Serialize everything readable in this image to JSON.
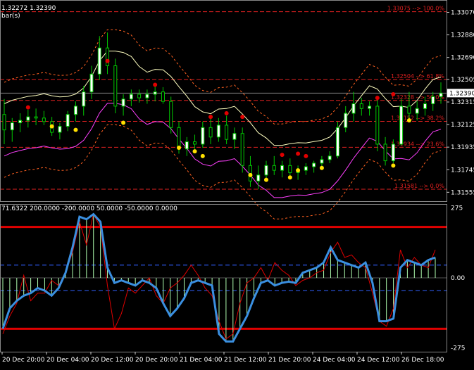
{
  "chart_data": [
    {
      "type": "candlestick",
      "header": {
        "price_text": "1.32272 1.32390",
        "indicator_text": "bar(s)"
      },
      "y_ticks": [
        "1.33070",
        "1.32880",
        "1.32690",
        "1.32505",
        "1.32315",
        "1.32125",
        "1.31935",
        "1.31745",
        "1.31555"
      ],
      "y_range": [
        1.3148,
        1.3315
      ],
      "current_price": "1.32390",
      "fibonacci": [
        {
          "label": "1.33075 --> 100.0%",
          "price": 1.33075
        },
        {
          "label": "1.32504 --> 61.8%",
          "price": 1.32504
        },
        {
          "label": "1.32328 --> 50.0%",
          "price": 1.32328
        },
        {
          "label": "1.32152 --> 38.2%",
          "price": 1.32152
        },
        {
          "label": "1.31934 --> 23.6%",
          "price": 1.31934
        },
        {
          "label": "1.31581 --> 0.0%",
          "price": 1.31581
        }
      ],
      "candles": [
        [
          1.3221,
          1.3234,
          1.3196,
          1.3208
        ],
        [
          1.3208,
          1.3218,
          1.3198,
          1.3214
        ],
        [
          1.3214,
          1.3222,
          1.3206,
          1.3216
        ],
        [
          1.3216,
          1.3225,
          1.321,
          1.3219
        ],
        [
          1.3219,
          1.3226,
          1.3212,
          1.3218
        ],
        [
          1.3218,
          1.3224,
          1.3212,
          1.3215
        ],
        [
          1.3215,
          1.3219,
          1.3203,
          1.3206
        ],
        [
          1.3206,
          1.3214,
          1.32,
          1.3211
        ],
        [
          1.3211,
          1.3224,
          1.3207,
          1.3221
        ],
        [
          1.3221,
          1.3232,
          1.3215,
          1.3228
        ],
        [
          1.3228,
          1.3245,
          1.322,
          1.324
        ],
        [
          1.324,
          1.3262,
          1.3234,
          1.3255
        ],
        [
          1.3255,
          1.3287,
          1.325,
          1.3277
        ],
        [
          1.3277,
          1.329,
          1.3255,
          1.3262
        ],
        [
          1.3262,
          1.3268,
          1.3222,
          1.3228
        ],
        [
          1.3228,
          1.3238,
          1.322,
          1.3234
        ],
        [
          1.3234,
          1.3242,
          1.3228,
          1.3238
        ],
        [
          1.3238,
          1.3242,
          1.3231,
          1.3235
        ],
        [
          1.3235,
          1.3242,
          1.323,
          1.3238
        ],
        [
          1.3238,
          1.3245,
          1.3232,
          1.324
        ],
        [
          1.324,
          1.3244,
          1.323,
          1.3232
        ],
        [
          1.3232,
          1.3236,
          1.3205,
          1.321
        ],
        [
          1.321,
          1.3215,
          1.3188,
          1.3192
        ],
        [
          1.3192,
          1.3202,
          1.3186,
          1.3198
        ],
        [
          1.3198,
          1.3204,
          1.3192,
          1.3196
        ],
        [
          1.3196,
          1.3215,
          1.3193,
          1.321
        ],
        [
          1.321,
          1.322,
          1.3196,
          1.3202
        ],
        [
          1.3202,
          1.3218,
          1.3198,
          1.3212
        ],
        [
          1.3212,
          1.322,
          1.3196,
          1.32
        ],
        [
          1.32,
          1.321,
          1.3192,
          1.3205
        ],
        [
          1.3205,
          1.321,
          1.3172,
          1.3178
        ],
        [
          1.3178,
          1.3186,
          1.316,
          1.3165
        ],
        [
          1.3165,
          1.3178,
          1.3158,
          1.317
        ],
        [
          1.317,
          1.3182,
          1.3165,
          1.3178
        ],
        [
          1.3178,
          1.3186,
          1.317,
          1.3174
        ],
        [
          1.3174,
          1.3182,
          1.3168,
          1.3178
        ],
        [
          1.3178,
          1.3184,
          1.317,
          1.3172
        ],
        [
          1.3172,
          1.3178,
          1.3166,
          1.3174
        ],
        [
          1.3174,
          1.318,
          1.317,
          1.3177
        ],
        [
          1.3177,
          1.3182,
          1.3172,
          1.318
        ],
        [
          1.318,
          1.3186,
          1.3176,
          1.3183
        ],
        [
          1.3183,
          1.319,
          1.318,
          1.3186
        ],
        [
          1.3186,
          1.3215,
          1.3184,
          1.321
        ],
        [
          1.321,
          1.3228,
          1.3206,
          1.3222
        ],
        [
          1.3222,
          1.324,
          1.3215,
          1.323
        ],
        [
          1.323,
          1.3235,
          1.322,
          1.3226
        ],
        [
          1.3226,
          1.3232,
          1.322,
          1.3228
        ],
        [
          1.3228,
          1.3233,
          1.319,
          1.3196
        ],
        [
          1.3196,
          1.3202,
          1.3178,
          1.3182
        ],
        [
          1.3182,
          1.32,
          1.318,
          1.3196
        ],
        [
          1.3196,
          1.3234,
          1.3195,
          1.3228
        ],
        [
          1.3228,
          1.324,
          1.3215,
          1.3222
        ],
        [
          1.3222,
          1.3232,
          1.3216,
          1.3226
        ],
        [
          1.3226,
          1.3236,
          1.322,
          1.323
        ],
        [
          1.323,
          1.324,
          1.3224,
          1.3236
        ],
        [
          1.3236,
          1.3248,
          1.323,
          1.3239
        ]
      ],
      "red_dots": [
        [
          3,
          1.3227
        ],
        [
          13,
          1.3266
        ],
        [
          19,
          1.3246
        ],
        [
          26,
          1.3219
        ],
        [
          28,
          1.3222
        ],
        [
          30,
          1.3219
        ],
        [
          35,
          1.3187
        ],
        [
          37,
          1.3188
        ],
        [
          38,
          1.3186
        ],
        [
          47,
          1.3235
        ],
        [
          49,
          1.3238
        ]
      ],
      "yellow_dots": [
        [
          6,
          1.3211
        ],
        [
          9,
          1.3208
        ],
        [
          15,
          1.3214
        ],
        [
          22,
          1.3193
        ],
        [
          24,
          1.319
        ],
        [
          25,
          1.3186
        ],
        [
          31,
          1.317
        ],
        [
          33,
          1.3166
        ],
        [
          36,
          1.3168
        ],
        [
          37,
          1.3174
        ],
        [
          40,
          1.3176
        ],
        [
          49,
          1.3178
        ],
        [
          51,
          1.3216
        ]
      ],
      "colors": {
        "up": "#ffffff",
        "down": "#ffffff",
        "wick": "#00c800",
        "grid": "#333333",
        "fib": "#e02020",
        "upper_band": "#ffffc0",
        "lower_band": "#ff40ff",
        "outer_bands": "#ff6020"
      }
    },
    {
      "type": "line",
      "header": {
        "label": "71.6322 200.0000 -200.0000 50.0000 -50.0000 0.0000"
      },
      "y_ticks": [
        "275",
        "0.00",
        "-275"
      ],
      "y_range": [
        -290,
        290
      ],
      "levels": [
        {
          "value": 200,
          "color": "#e00000"
        },
        {
          "value": -200,
          "color": "#e00000"
        },
        {
          "value": 50,
          "color": "#3060ff"
        },
        {
          "value": -50,
          "color": "#3060ff"
        }
      ],
      "x_labels": [
        "20 Dec 20:00",
        "20 Dec 04:00",
        "20 Dec 12:00",
        "20 Dec 20:00",
        "21 Dec 04:00",
        "21 Dec 12:00",
        "21 Dec 20:00",
        "24 Dec 04:00",
        "24 Dec 12:00",
        "26 Dec 18:00"
      ],
      "series": [
        {
          "name": "",
          "color": "#3a8fe0",
          "values": [
            -200,
            -120,
            -90,
            -70,
            -60,
            -40,
            -50,
            -70,
            -40,
            20,
            120,
            240,
            230,
            250,
            220,
            40,
            -20,
            -10,
            -20,
            -30,
            -10,
            -20,
            -40,
            -100,
            -150,
            -120,
            -80,
            -20,
            -10,
            -20,
            -30,
            -220,
            -250,
            -250,
            -200,
            -150,
            -80,
            -20,
            -10,
            -30,
            -20,
            -15,
            -20,
            20,
            30,
            40,
            60,
            120,
            70,
            60,
            50,
            40,
            60,
            -20,
            -170,
            -170,
            -160,
            40,
            70,
            60,
            50,
            70,
            80
          ]
        },
        {
          "name": "",
          "color": "#e00000",
          "values": [
            -220,
            -150,
            -100,
            10,
            -90,
            -60,
            -60,
            -10,
            -30,
            20,
            100,
            220,
            130,
            250,
            200,
            -30,
            -200,
            -140,
            -40,
            -60,
            -30,
            0,
            -70,
            -100,
            -40,
            -20,
            10,
            50,
            10,
            -40,
            -70,
            -170,
            -240,
            -220,
            -100,
            -20,
            0,
            40,
            -10,
            60,
            30,
            10,
            -30,
            -10,
            0,
            20,
            30,
            100,
            140,
            80,
            90,
            60,
            40,
            -60,
            -170,
            -190,
            -120,
            110,
            40,
            80,
            50,
            40,
            110
          ]
        }
      ],
      "histogram_color": "#b0ffb0"
    }
  ]
}
